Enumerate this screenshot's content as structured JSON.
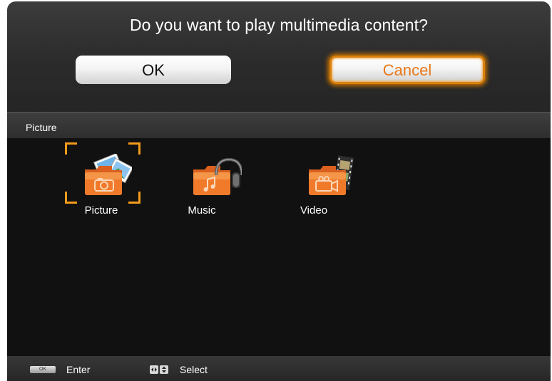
{
  "dialog": {
    "question": "Do you want to play multimedia content?",
    "ok_label": "OK",
    "cancel_label": "Cancel",
    "focused_button": "Cancel"
  },
  "panel": {
    "title": "Picture",
    "items": [
      {
        "label": "Picture",
        "icon": "picture-folder-icon",
        "selected": true
      },
      {
        "label": "Music",
        "icon": "music-folder-icon",
        "selected": false
      },
      {
        "label": "Video",
        "icon": "video-folder-icon",
        "selected": false
      }
    ]
  },
  "footer": {
    "ok_key_label": "OK",
    "enter_label": "Enter",
    "nav_keys_icon": "arrow-keys-icon",
    "select_label": "Select"
  },
  "colors": {
    "accent": "#f59b1b",
    "cancel_text": "#e8781a",
    "folder": "#f07a2a",
    "panel_bg": "#111111"
  }
}
